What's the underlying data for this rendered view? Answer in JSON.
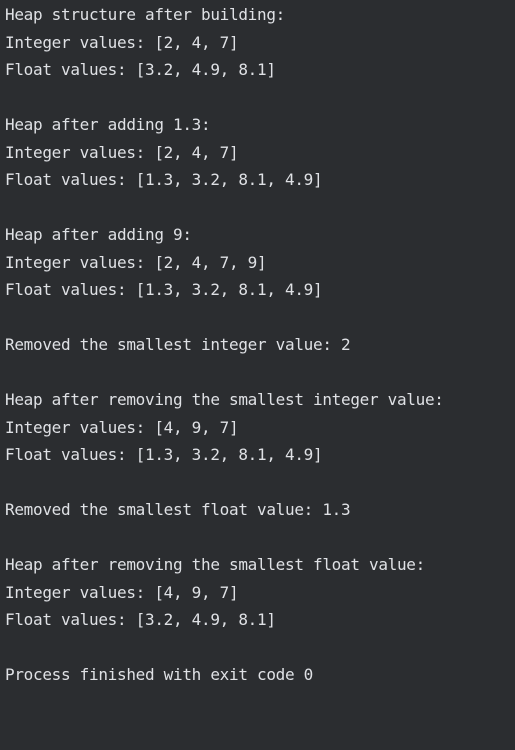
{
  "console": {
    "lines": [
      "Heap structure after building:",
      "Integer values: [2, 4, 7]",
      "Float values: [3.2, 4.9, 8.1]",
      "",
      "Heap after adding 1.3:",
      "Integer values: [2, 4, 7]",
      "Float values: [1.3, 3.2, 8.1, 4.9]",
      "",
      "Heap after adding 9:",
      "Integer values: [2, 4, 7, 9]",
      "Float values: [1.3, 3.2, 8.1, 4.9]",
      "",
      "Removed the smallest integer value: 2",
      "",
      "Heap after removing the smallest integer value:",
      "Integer values: [4, 9, 7]",
      "Float values: [1.3, 3.2, 8.1, 4.9]",
      "",
      "Removed the smallest float value: 1.3",
      "",
      "Heap after removing the smallest float value:",
      "Integer values: [4, 9, 7]",
      "Float values: [3.2, 4.9, 8.1]",
      "",
      "Process finished with exit code 0"
    ]
  }
}
